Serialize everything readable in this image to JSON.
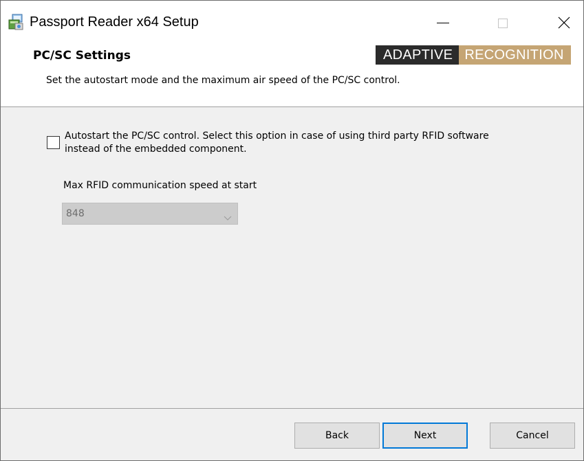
{
  "window": {
    "title": "Passport Reader x64 Setup",
    "controls": {
      "minimize": "minimize-icon",
      "maximize": "maximize-icon",
      "close": "close-icon"
    }
  },
  "header": {
    "title": "PC/SC Settings",
    "description": "Set the autostart mode and the maximum air speed of the PC/SC control.",
    "brand": {
      "part1": "ADAPTIVE",
      "part2": "RECOGNITION",
      "colors": {
        "dark": "#2b2b2b",
        "gold": "#c5a574"
      }
    }
  },
  "content": {
    "autostart": {
      "label": "Autostart the PC/SC control. Select this option in case of using third party RFID software instead of the embedded component.",
      "checked": false
    },
    "speed": {
      "label": "Max RFID communication speed at start",
      "value": "848",
      "disabled": true
    }
  },
  "footer": {
    "back": "Back",
    "next": "Next",
    "cancel": "Cancel"
  },
  "colors": {
    "accent": "#0078d7",
    "window_bg": "#f0f0f0"
  }
}
